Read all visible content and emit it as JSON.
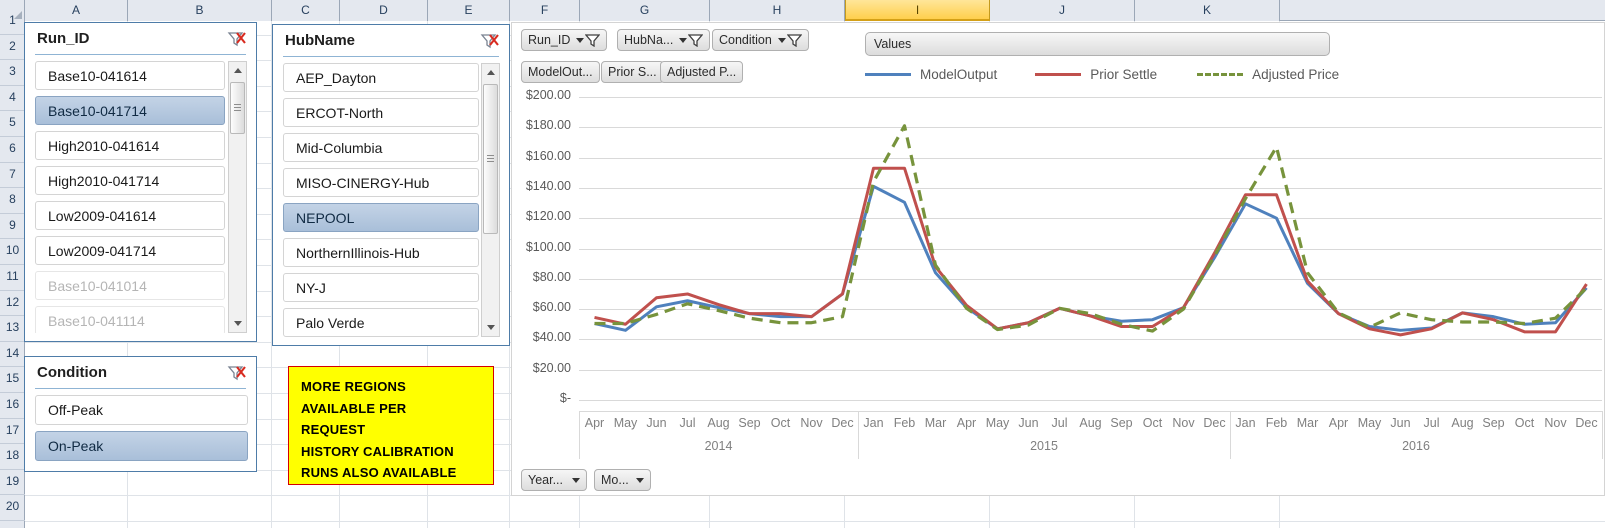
{
  "sheet": {
    "columns": [
      "A",
      "B",
      "C",
      "D",
      "E",
      "F",
      "G",
      "H",
      "I",
      "J",
      "K"
    ],
    "selected_column": "I",
    "rows": [
      "1",
      "2",
      "3",
      "4",
      "5",
      "6",
      "7",
      "8",
      "9",
      "10",
      "11",
      "12",
      "13",
      "14",
      "15",
      "16",
      "17",
      "18",
      "19",
      "20"
    ]
  },
  "slicers": [
    {
      "name": "run-id",
      "title": "Run_ID",
      "clear_icon": "clear-filter-icon",
      "items": [
        {
          "label": "Base10-041614",
          "state": "normal"
        },
        {
          "label": "Base10-041714",
          "state": "selected"
        },
        {
          "label": "High2010-041614",
          "state": "normal"
        },
        {
          "label": "High2010-041714",
          "state": "normal"
        },
        {
          "label": "Low2009-041614",
          "state": "normal"
        },
        {
          "label": "Low2009-041714",
          "state": "normal"
        },
        {
          "label": "Base10-041014",
          "state": "disabled"
        },
        {
          "label": "Base10-041114",
          "state": "disabled"
        }
      ]
    },
    {
      "name": "hub-name",
      "title": "HubName",
      "clear_icon": "clear-filter-icon",
      "items": [
        {
          "label": "AEP_Dayton",
          "state": "normal"
        },
        {
          "label": "ERCOT-North",
          "state": "normal"
        },
        {
          "label": "Mid-Columbia",
          "state": "normal"
        },
        {
          "label": "MISO-CINERGY-Hub",
          "state": "normal"
        },
        {
          "label": "NEPOOL",
          "state": "selected"
        },
        {
          "label": "NorthernIllinois-Hub",
          "state": "normal"
        },
        {
          "label": "NY-J",
          "state": "normal"
        },
        {
          "label": "Palo Verde",
          "state": "normal"
        }
      ]
    },
    {
      "name": "condition",
      "title": "Condition",
      "clear_icon": "clear-filter-icon",
      "items": [
        {
          "label": "Off-Peak",
          "state": "normal"
        },
        {
          "label": "On-Peak",
          "state": "selected"
        }
      ]
    }
  ],
  "note": {
    "lines": [
      "MORE REGIONS",
      "AVAILABLE PER",
      "REQUEST",
      "HISTORY CALIBRATION",
      "RUNS ALSO AVAILABLE"
    ],
    "background": "#ffff00",
    "border": "#d40000"
  },
  "chart_filters": {
    "field_buttons": [
      {
        "label": "Run_ID",
        "icon": "filter-dropdown-icon"
      },
      {
        "label": "HubNa...",
        "icon": "filter-dropdown-icon"
      },
      {
        "label": "Condition",
        "icon": "filter-dropdown-icon"
      }
    ],
    "value_buttons": [
      {
        "label": "ModelOut..."
      },
      {
        "label": "Prior S..."
      },
      {
        "label": "Adjusted P..."
      }
    ],
    "values_button": {
      "label": "Values"
    },
    "axis_buttons": [
      {
        "label": "Year...",
        "icon": "dropdown-icon"
      },
      {
        "label": "Mo...",
        "icon": "dropdown-icon"
      }
    ]
  },
  "chart_data": {
    "type": "line",
    "title": "",
    "xlabel": "",
    "ylabel": "",
    "ylim": [
      0,
      200
    ],
    "ytick_labels": [
      "$200.00",
      "$180.00",
      "$160.00",
      "$140.00",
      "$120.00",
      "$100.00",
      "$80.00",
      "$60.00",
      "$40.00",
      "$20.00",
      "$-"
    ],
    "ytick_values": [
      200,
      180,
      160,
      140,
      120,
      100,
      80,
      60,
      40,
      20,
      0
    ],
    "grid": true,
    "legend_position": "top",
    "x": [
      "Apr",
      "May",
      "Jun",
      "Jul",
      "Aug",
      "Sep",
      "Oct",
      "Nov",
      "Dec",
      "Jan",
      "Feb",
      "Mar",
      "Apr",
      "May",
      "Jun",
      "Jul",
      "Aug",
      "Sep",
      "Oct",
      "Nov",
      "Dec",
      "Jan",
      "Feb",
      "Mar",
      "Apr",
      "May",
      "Jun",
      "Jul",
      "Aug",
      "Sep",
      "Oct",
      "Nov",
      "Dec"
    ],
    "year_groups": [
      {
        "year": "2014",
        "months": [
          "Apr",
          "May",
          "Jun",
          "Jul",
          "Aug",
          "Sep",
          "Oct",
          "Nov",
          "Dec"
        ]
      },
      {
        "year": "2015",
        "months": [
          "Jan",
          "Feb",
          "Mar",
          "Apr",
          "May",
          "Jun",
          "Jul",
          "Aug",
          "Sep",
          "Oct",
          "Nov",
          "Dec"
        ]
      },
      {
        "year": "2016",
        "months": [
          "Jan",
          "Feb",
          "Mar",
          "Apr",
          "May",
          "Jun",
          "Jul",
          "Aug",
          "Sep",
          "Oct",
          "Nov",
          "Dec"
        ]
      }
    ],
    "series": [
      {
        "name": "ModelOutput",
        "color": "#4f81bd",
        "style": "solid",
        "values": [
          50.5,
          46.0,
          61.5,
          65.5,
          61.0,
          57.0,
          55.0,
          55.0,
          70.0,
          141.0,
          130.5,
          84.0,
          61.0,
          47.0,
          51.0,
          60.5,
          55.5,
          52.0,
          53.0,
          61.0,
          94.0,
          129.5,
          120.0,
          77.0,
          57.0,
          48.5,
          46.0,
          47.5,
          57.5,
          55.0,
          50.0,
          51.0,
          74.0
        ]
      },
      {
        "name": "Prior Settle",
        "color": "#c0504d",
        "style": "solid",
        "values": [
          54.5,
          50.0,
          67.5,
          70.0,
          63.0,
          57.0,
          57.0,
          55.0,
          70.0,
          153.0,
          153.0,
          88.0,
          62.5,
          47.0,
          51.0,
          60.5,
          55.5,
          48.5,
          48.5,
          61.0,
          97.0,
          135.5,
          135.5,
          78.5,
          57.0,
          47.0,
          43.0,
          47.0,
          57.5,
          53.0,
          45.0,
          45.0,
          76.5
        ]
      },
      {
        "name": "Adjusted Price",
        "color": "#77933c",
        "style": "dashed",
        "values": [
          50.5,
          50.5,
          56.5,
          63.5,
          59.0,
          54.0,
          51.0,
          51.0,
          55.0,
          144.0,
          181.0,
          89.0,
          60.5,
          46.5,
          49.5,
          60.5,
          57.0,
          50.0,
          45.5,
          60.0,
          95.0,
          133.0,
          167.0,
          84.0,
          57.5,
          48.0,
          57.5,
          53.0,
          51.5,
          51.5,
          50.5,
          54.0,
          74.0
        ]
      }
    ]
  }
}
